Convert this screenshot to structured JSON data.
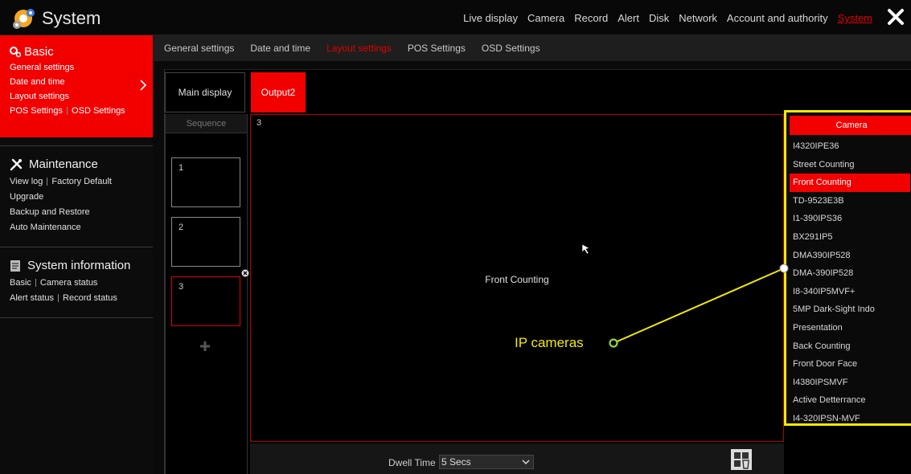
{
  "app": {
    "title": "System"
  },
  "topnav": {
    "items": [
      "Live display",
      "Camera",
      "Record",
      "Alert",
      "Disk",
      "Network",
      "Account and authority",
      "System"
    ],
    "active": "System"
  },
  "sidebar": {
    "basic": {
      "title": "Basic",
      "general": "General settings",
      "date": "Date and time",
      "layout": "Layout settings",
      "pos": "POS Settings",
      "osd": "OSD Settings"
    },
    "maintenance": {
      "title": "Maintenance",
      "view_log": "View log",
      "factory_default": "Factory Default",
      "upgrade": "Upgrade",
      "backup": "Backup and Restore",
      "auto": "Auto Maintenance"
    },
    "sysinfo": {
      "title": "System information",
      "basic": "Basic",
      "camera_status": "Camera status",
      "alert_status": "Alert status",
      "record_status": "Record status"
    }
  },
  "subtabs": {
    "items": [
      "General settings",
      "Date and time",
      "Layout settings",
      "POS Settings",
      "OSD Settings"
    ],
    "active": "Layout settings"
  },
  "display_tabs": {
    "main": "Main display",
    "output2": "Output2"
  },
  "sequence": {
    "header": "Sequence",
    "items": [
      "1",
      "2",
      "3"
    ],
    "selected": "3"
  },
  "preview": {
    "number": "3",
    "camera_name": "Front Counting"
  },
  "dwell": {
    "label": "Dwell Time",
    "value": "5 Secs"
  },
  "camera_panel": {
    "header": "Camera",
    "items": [
      "I4320IPE36",
      "Street Counting",
      "Front Counting",
      "TD-9523E3B",
      "I1-390IPS36",
      "BX291IP5",
      "DMA390IP528",
      "DMA-390IP528",
      "I8-340IP5MVF+",
      "5MP Dark-Sight Indo",
      "Presentation",
      "Back Counting",
      "Front Door Face",
      "I4380IPSMVF",
      "Active Detterrance",
      "I4-320IPSN-MVF"
    ],
    "selected": "Front Counting"
  },
  "annotation": {
    "label": "IP cameras"
  },
  "colors": {
    "accent_red": "#f20000",
    "annotation_yellow": "#f3ea00"
  }
}
